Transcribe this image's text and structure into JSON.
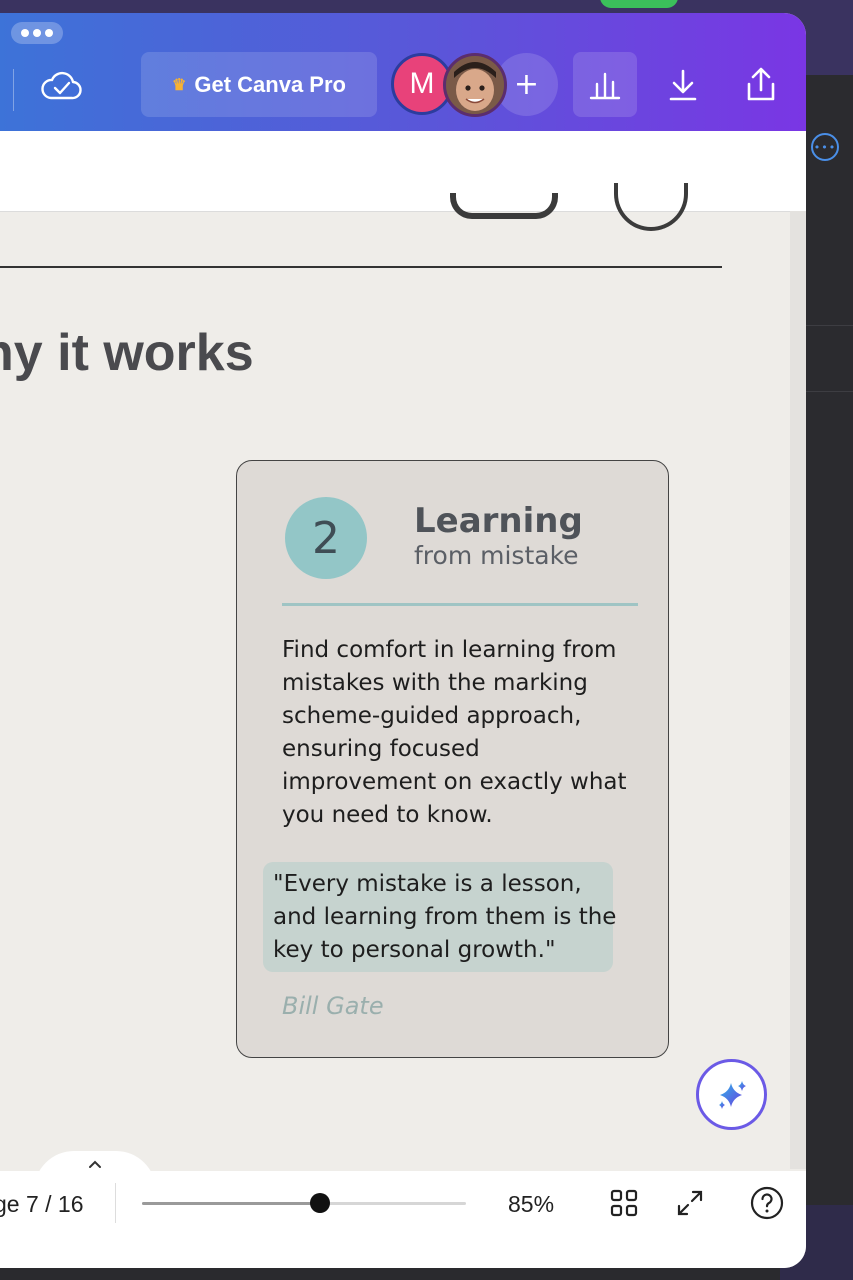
{
  "toolbar": {
    "get_pro_label": "Get Canva Pro",
    "avatar_initial": "M",
    "add_collaborator_symbol": "+",
    "icons": [
      "cloud-check-icon",
      "crown-icon",
      "bar-chart-icon",
      "download-icon",
      "share-icon",
      "more-icon"
    ]
  },
  "colors": {
    "topbar_start": "#3d73d8",
    "topbar_end": "#7a36e4",
    "avatar_m": "#e8427a",
    "number_circle": "#93c6c7",
    "quote_highlight": "#c6d3cf",
    "card_bg": "#dedad6"
  },
  "canvas": {
    "heading": "ny it works",
    "card": {
      "number": "2",
      "title": "Learning",
      "subtitle": "from mistake",
      "body": "Find comfort in learning from mistakes with the marking scheme-guided approach, ensuring focused improvement on exactly what you need to know.",
      "quote": "\"Every mistake is a lesson, and learning from them is the key to personal growth.\"",
      "author": "Bill Gate"
    }
  },
  "footer": {
    "page_indicator": "ge 7 / 16",
    "zoom_level": 0.55,
    "zoom_label": "85%",
    "icons": [
      "grid-view-icon",
      "fullscreen-icon",
      "help-icon",
      "magic-sparkle-icon",
      "chevron-up-icon"
    ]
  }
}
